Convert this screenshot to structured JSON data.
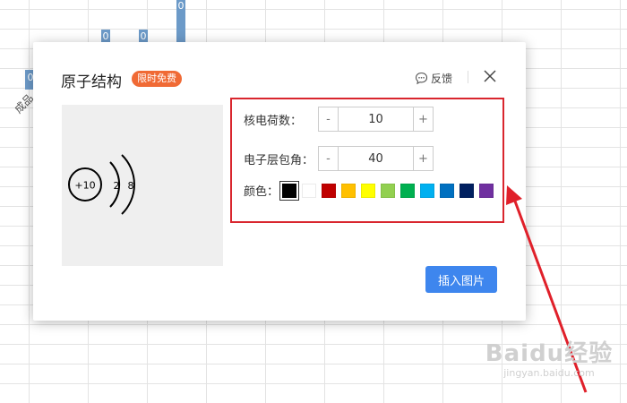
{
  "background": {
    "bar_labels": [
      "0",
      "0",
      "0",
      "0"
    ],
    "axis_label": "成品"
  },
  "dialog": {
    "title": "原子结构",
    "badge": "限时免费",
    "feedback_label": "反馈",
    "close_icon": "close-icon",
    "feedback_icon": "chat-bubble-icon"
  },
  "preview": {
    "nucleus_label": "+10",
    "shell_counts": [
      "2",
      "8"
    ]
  },
  "settings": {
    "nuclear_charge": {
      "label": "核电荷数：",
      "value": "10",
      "decrement": "-",
      "increment": "+"
    },
    "shell_angle": {
      "label": "电子层包角：",
      "value": "40",
      "decrement": "-",
      "increment": "+"
    },
    "color": {
      "label": "颜色：",
      "selected_index": 0,
      "swatches": [
        "#000000",
        "#ffffff",
        "#c00000",
        "#ffc000",
        "#ffff00",
        "#92d050",
        "#00b050",
        "#00b0f0",
        "#0070c0",
        "#002060",
        "#7030a0"
      ]
    }
  },
  "insert_button_label": "插入图片",
  "colors": {
    "accent": "#3e86ee",
    "highlight": "#d9262e",
    "badge": "#f06a35"
  },
  "watermark": {
    "logo": "Baidu经验",
    "url": "jingyan.baidu.com"
  }
}
